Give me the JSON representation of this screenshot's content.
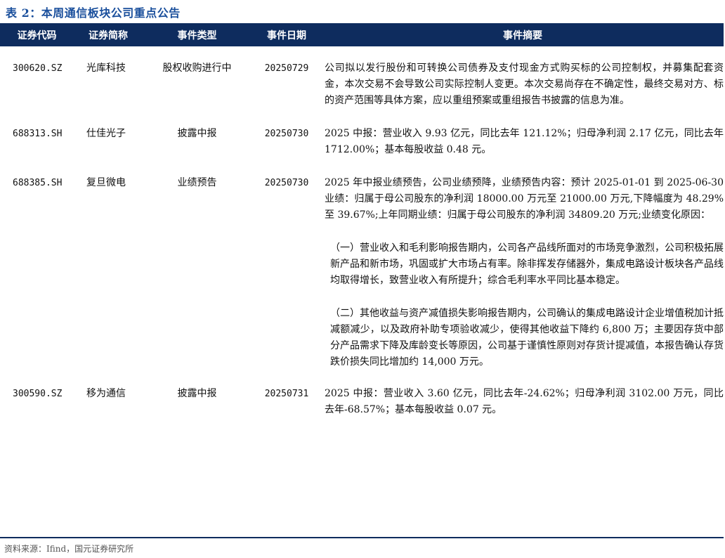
{
  "title": "表 2：本周通信板块公司重点公告",
  "headers": [
    "证券代码",
    "证券简称",
    "事件类型",
    "事件日期",
    "事件摘要"
  ],
  "rows": [
    {
      "code": "300620.SZ",
      "name": "光库科技",
      "type": "股权收购进行中",
      "date": "20250729",
      "summary": [
        "公司拟以发行股份和可转换公司债券及支付现金方式购买标的公司控制权，并募集配套资金，本次交易不会导致公司实际控制人变更。本次交易尚存在不确定性，最终交易对方、标的资产范围等具体方案，应以重组预案或重组报告书披露的信息为准。"
      ]
    },
    {
      "code": "688313.SH",
      "name": "仕佳光子",
      "type": "披露中报",
      "date": "20250730",
      "summary": [
        "2025 中报：营业收入 9.93 亿元，同比去年 121.12%；归母净利润 2.17 亿元，同比去年 1712.00%；基本每股收益 0.48 元。"
      ]
    },
    {
      "code": "688385.SH",
      "name": "复旦微电",
      "type": "业绩预告",
      "date": "20250730",
      "summary": [
        "2025 年中报业绩预告，公司业绩预降，业绩预告内容：预计 2025-01-01 到 2025-06-30 业绩：归属于母公司股东的净利润 18000.00 万元至 21000.00 万元,下降幅度为 48.29%至 39.67%;上年同期业绩：归属于母公司股东的净利润 34809.20 万元;业绩变化原因：",
        "（一）营业收入和毛利影响报告期内，公司各产品线所面对的市场竞争激烈，公司积极拓展新产品和新市场，巩固或扩大市场占有率。除非挥发存储器外，集成电路设计板块各产品线均取得增长，致营业收入有所提升；综合毛利率水平同比基本稳定。",
        "（二）其他收益与资产减值损失影响报告期内，公司确认的集成电路设计企业增值税加计抵减额减少，以及政府补助专项验收减少，使得其他收益下降约 6,800 万；主要因存货中部分产品需求下降及库龄变长等原因，公司基于谨慎性原则对存货计提减值，本报告确认存货跌价损失同比增加约 14,000 万元。"
      ]
    },
    {
      "code": "300590.SZ",
      "name": "移为通信",
      "type": "披露中报",
      "date": "20250731",
      "summary": [
        "2025 中报：营业收入 3.60 亿元，同比去年-24.62%；归母净利润 3102.00 万元，同比去年-68.57%；基本每股收益 0.07 元。"
      ]
    }
  ],
  "source": "资料来源：Ifind，国元证券研究所"
}
